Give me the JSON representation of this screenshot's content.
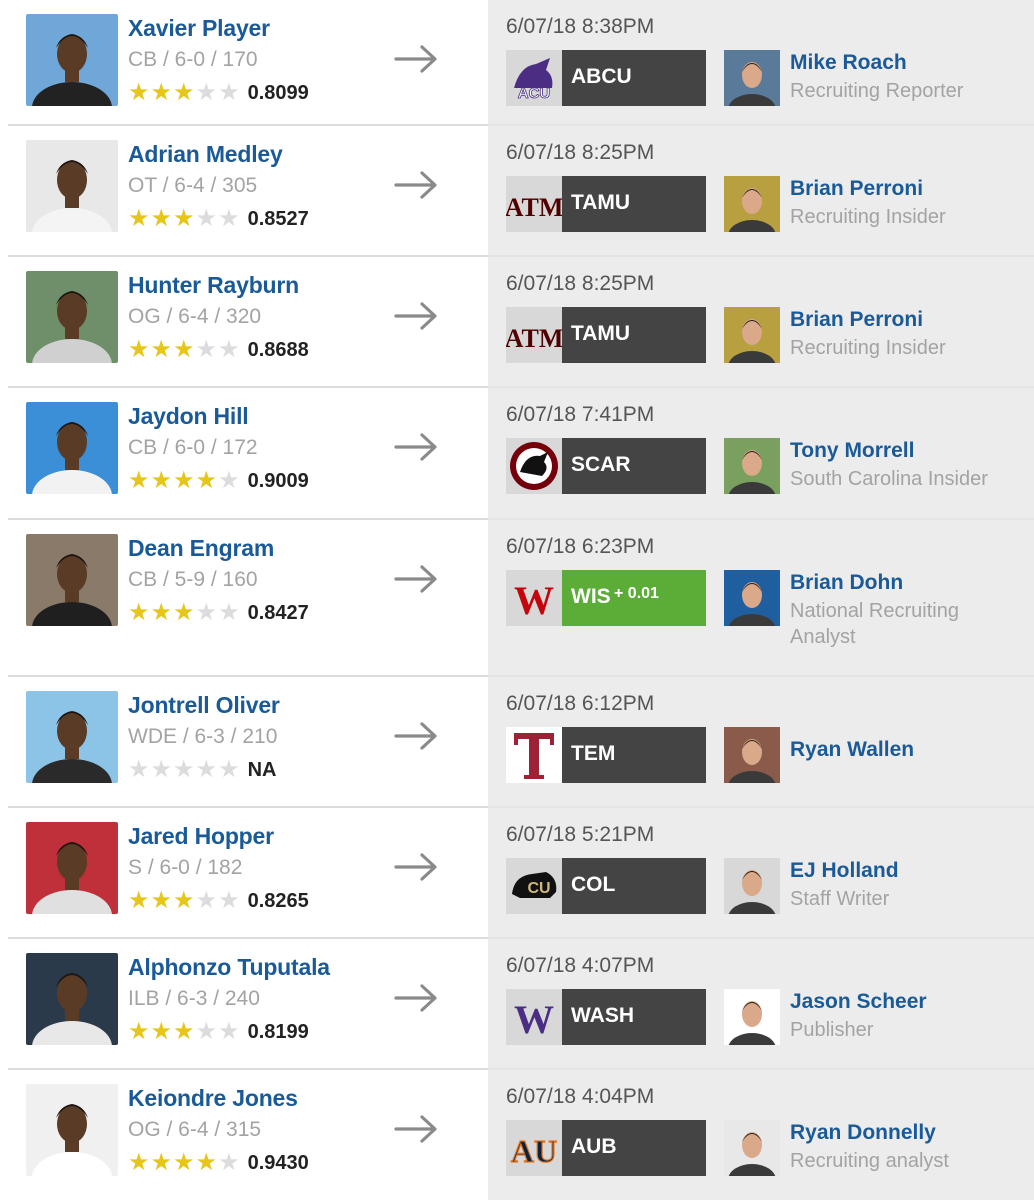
{
  "rows": [
    {
      "player": {
        "name": "Xavier Player",
        "position_info": "CB / 6-0 / 170",
        "stars": 3,
        "rating": "0.8099",
        "photo_bg": "#6fa8d8",
        "shirt": "#222222"
      },
      "pick": {
        "timestamp": "6/07/18 8:38PM",
        "team_abbr": "ABCU",
        "team_delta": "",
        "team_logo_icon": "abcu-wildcat-logo-icon",
        "team_color": "#4b2e83",
        "team_box_color": "#444444"
      },
      "reporter": {
        "name": "Mike Roach",
        "title": "Recruiting Reporter",
        "photo_bg": "#5a7a9a"
      }
    },
    {
      "player": {
        "name": "Adrian Medley",
        "position_info": "OT / 6-4 / 305",
        "stars": 3,
        "rating": "0.8527",
        "photo_bg": "#e8e8e8",
        "shirt": "#f4f4f4"
      },
      "pick": {
        "timestamp": "6/07/18 8:25PM",
        "team_abbr": "TAMU",
        "team_delta": "",
        "team_logo_icon": "tamu-atm-logo-icon",
        "team_color": "#500000",
        "team_box_color": "#444444"
      },
      "reporter": {
        "name": "Brian Perroni",
        "title": "Recruiting Insider",
        "photo_bg": "#b8a040"
      }
    },
    {
      "player": {
        "name": "Hunter Rayburn",
        "position_info": "OG / 6-4 / 320",
        "stars": 3,
        "rating": "0.8688",
        "photo_bg": "#6f8f6a",
        "shirt": "#d0d0d0"
      },
      "pick": {
        "timestamp": "6/07/18 8:25PM",
        "team_abbr": "TAMU",
        "team_delta": "",
        "team_logo_icon": "tamu-atm-logo-icon",
        "team_color": "#500000",
        "team_box_color": "#444444"
      },
      "reporter": {
        "name": "Brian Perroni",
        "title": "Recruiting Insider",
        "photo_bg": "#b8a040"
      }
    },
    {
      "player": {
        "name": "Jaydon Hill",
        "position_info": "CB / 6-0 / 172",
        "stars": 4,
        "rating": "0.9009",
        "photo_bg": "#3b8fd6",
        "shirt": "#f2f2f2"
      },
      "pick": {
        "timestamp": "6/07/18 7:41PM",
        "team_abbr": "SCAR",
        "team_delta": "",
        "team_logo_icon": "south-carolina-gamecock-logo-icon",
        "team_color": "#73000a",
        "team_box_color": "#444444"
      },
      "reporter": {
        "name": "Tony Morrell",
        "title": "South Carolina Insider",
        "photo_bg": "#7aa060"
      }
    },
    {
      "player": {
        "name": "Dean Engram",
        "position_info": "CB / 5-9 / 160",
        "stars": 3,
        "rating": "0.8427",
        "photo_bg": "#8a7a6a",
        "shirt": "#1f1f1f"
      },
      "pick": {
        "timestamp": "6/07/18 6:23PM",
        "team_abbr": "WIS",
        "team_delta": "+ 0.01",
        "team_logo_icon": "wisconsin-w-logo-icon",
        "team_color": "#c5050c",
        "team_box_color": "#5cad37"
      },
      "reporter": {
        "name": "Brian Dohn",
        "title": "National Recruiting Analyst",
        "photo_bg": "#1f5fa0"
      }
    },
    {
      "player": {
        "name": "Jontrell Oliver",
        "position_info": "WDE / 6-3 / 210",
        "stars": 0,
        "rating": "NA",
        "photo_bg": "#8cc4e8",
        "shirt": "#2a2a2a"
      },
      "pick": {
        "timestamp": "6/07/18 6:12PM",
        "team_abbr": "TEM",
        "team_delta": "",
        "team_logo_icon": "temple-t-logo-icon",
        "team_color": "#9d2235",
        "team_box_color": "#444444"
      },
      "reporter": {
        "name": "Ryan Wallen",
        "title": "",
        "photo_bg": "#8a5a4a"
      }
    },
    {
      "player": {
        "name": "Jared Hopper",
        "position_info": "S / 6-0 / 182",
        "stars": 3,
        "rating": "0.8265",
        "photo_bg": "#c0303a",
        "shirt": "#e0e0e0"
      },
      "pick": {
        "timestamp": "6/07/18 5:21PM",
        "team_abbr": "COL",
        "team_delta": "",
        "team_logo_icon": "colorado-buffalo-logo-icon",
        "team_color": "#cfb87c",
        "team_box_color": "#444444"
      },
      "reporter": {
        "name": "EJ Holland",
        "title": "Staff Writer",
        "photo_bg": "#d8d8d8"
      }
    },
    {
      "player": {
        "name": "Alphonzo Tuputala",
        "position_info": "ILB / 6-3 / 240",
        "stars": 3,
        "rating": "0.8199",
        "photo_bg": "#2a3a4a",
        "shirt": "#e8e8e8"
      },
      "pick": {
        "timestamp": "6/07/18 4:07PM",
        "team_abbr": "WASH",
        "team_delta": "",
        "team_logo_icon": "washington-w-logo-icon",
        "team_color": "#4b2e83",
        "team_box_color": "#444444"
      },
      "reporter": {
        "name": "Jason Scheer",
        "title": "Publisher",
        "photo_bg": "#ffffff"
      }
    },
    {
      "player": {
        "name": "Keiondre Jones",
        "position_info": "OG / 6-4 / 315",
        "stars": 4,
        "rating": "0.9430",
        "photo_bg": "#f0f0f0",
        "shirt": "#ffffff"
      },
      "pick": {
        "timestamp": "6/07/18 4:04PM",
        "team_abbr": "AUB",
        "team_delta": "",
        "team_logo_icon": "auburn-au-logo-icon",
        "team_color": "#0c2340",
        "team_box_color": "#444444"
      },
      "reporter": {
        "name": "Ryan Donnelly",
        "title": "Recruiting analyst",
        "photo_bg": "#e8e8e8"
      }
    }
  ],
  "icons": {
    "arrow": "right-arrow-icon",
    "star": "star-icon"
  },
  "colors": {
    "name_link": "#1a5a98",
    "star_filled": "#e6c619",
    "star_empty": "#dcdcdc",
    "right_panel_bg": "#ececec",
    "team_box": "#444444",
    "positive_change": "#5cad37"
  }
}
